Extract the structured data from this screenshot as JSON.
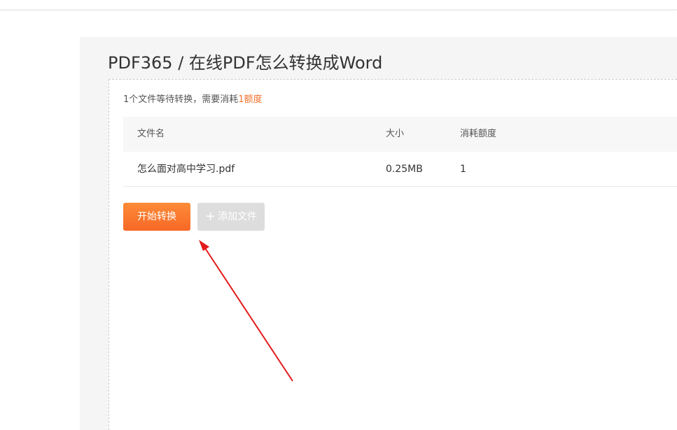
{
  "header": {
    "page_title": "PDF365 / 在线PDF怎么转换成Word"
  },
  "summary": {
    "prefix": "1个文件等待转换，需要消耗",
    "highlight": "1额度"
  },
  "table": {
    "columns": [
      "文件名",
      "大小",
      "消耗额度"
    ],
    "rows": [
      {
        "name": "怎么面对高中学习.pdf",
        "size": "0.25MB",
        "cost": "1"
      }
    ]
  },
  "actions": {
    "start_label": "开始转换",
    "add_label": "添加文件",
    "add_icon": "+"
  },
  "colors": {
    "accent": "#f0702a",
    "annotation_arrow": "#e31b1b"
  }
}
